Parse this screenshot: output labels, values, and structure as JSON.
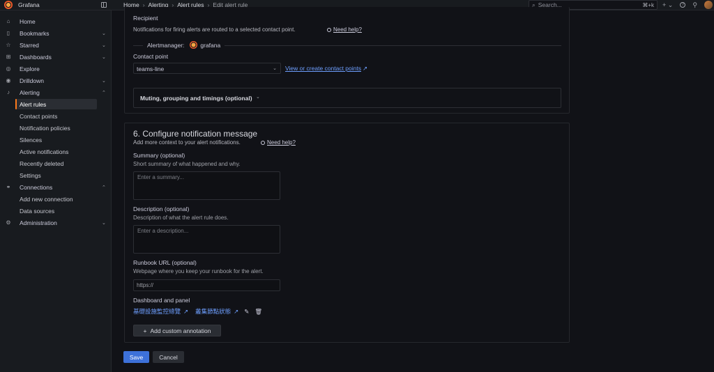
{
  "app": {
    "name": "Grafana"
  },
  "breadcrumbs": [
    "Home",
    "Alerting",
    "Alert rules",
    "Edit alert rule"
  ],
  "search": {
    "placeholder": "Search...",
    "shortcut": "⌘+k"
  },
  "topbar_right": {
    "add": "+",
    "help": "?",
    "new": "⌁"
  },
  "sidebar": {
    "items": [
      {
        "label": "Home",
        "icon": "home-icon",
        "glyph": "⌂",
        "chevron": ""
      },
      {
        "label": "Bookmarks",
        "icon": "bookmark-icon",
        "glyph": "▯",
        "chevron": "⌄"
      },
      {
        "label": "Starred",
        "icon": "star-icon",
        "glyph": "☆",
        "chevron": "⌄"
      },
      {
        "label": "Dashboards",
        "icon": "dashboards-icon",
        "glyph": "⊞",
        "chevron": "⌄"
      },
      {
        "label": "Explore",
        "icon": "compass-icon",
        "glyph": "◎",
        "chevron": ""
      },
      {
        "label": "Drilldown",
        "icon": "drilldown-icon",
        "glyph": "◉",
        "chevron": "⌄"
      },
      {
        "label": "Alerting",
        "icon": "bell-icon",
        "glyph": "♪",
        "chevron": "⌃"
      },
      {
        "label": "Alert rules",
        "sub": true,
        "active": true
      },
      {
        "label": "Contact points",
        "sub": true
      },
      {
        "label": "Notification policies",
        "sub": true
      },
      {
        "label": "Silences",
        "sub": true
      },
      {
        "label": "Active notifications",
        "sub": true
      },
      {
        "label": "Recently deleted",
        "sub": true
      },
      {
        "label": "Settings",
        "sub": true
      },
      {
        "label": "Connections",
        "icon": "connections-icon",
        "glyph": "⚭",
        "chevron": "⌃"
      },
      {
        "label": "Add new connection",
        "sub": true
      },
      {
        "label": "Data sources",
        "sub": true
      },
      {
        "label": "Administration",
        "icon": "cog-icon",
        "glyph": "⚙",
        "chevron": "⌄"
      }
    ]
  },
  "recipient": {
    "title": "Recipient",
    "description": "Notifications for firing alerts are routed to a selected contact point.",
    "help": "Need help?",
    "alertmanager_label": "Alertmanager:",
    "alertmanager_value": "grafana",
    "contact_point_label": "Contact point",
    "contact_point_value": "teams-line",
    "contact_link": "View or create contact points",
    "muting_label": "Muting, grouping and timings (optional)"
  },
  "notification": {
    "title": "6. Configure notification message",
    "description": "Add more context to your alert notifications.",
    "help": "Need help?",
    "summary_label": "Summary (optional)",
    "summary_desc": "Short summary of what happened and why.",
    "summary_placeholder": "Enter a summary...",
    "description_label": "Description (optional)",
    "description_desc": "Description of what the alert rule does.",
    "description_placeholder": "Enter a description...",
    "runbook_label": "Runbook URL (optional)",
    "runbook_desc": "Webpage where you keep your runbook for the alert.",
    "runbook_placeholder": "https://",
    "dashboard_label": "Dashboard and panel",
    "dashboard_link": "基礎設施監控總覽",
    "panel_link": "叢集節點狀態",
    "add_annotation": "Add custom annotation"
  },
  "actions": {
    "save": "Save",
    "cancel": "Cancel"
  },
  "colors": {
    "accent": "#ff7a1a",
    "primary": "#3d71d9",
    "link": "#6e9fff"
  }
}
